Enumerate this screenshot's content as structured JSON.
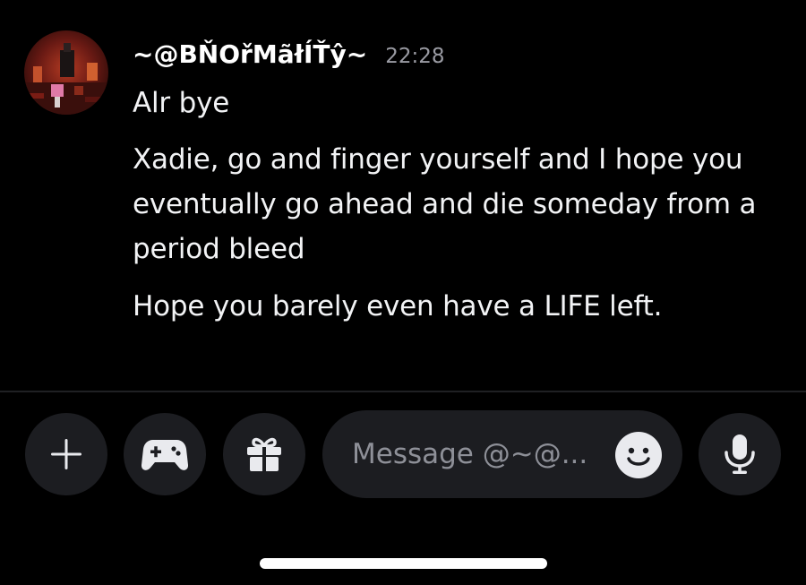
{
  "message": {
    "username": "~@BŇOřMãłÍŤŷ~",
    "timestamp": "22:28",
    "lines": [
      "Alr bye",
      "Xadie, go and finger yourself and I hope you eventually go ahead and die someday from a period bleed",
      "Hope you barely even have a LIFE left."
    ]
  },
  "composer": {
    "placeholder": "Message @~@...",
    "buttons": {
      "plus": "plus-icon",
      "games": "gamepad-icon",
      "gift": "gift-icon",
      "emoji": "smiley-icon",
      "mic": "microphone-icon"
    }
  },
  "colors": {
    "background": "#000000",
    "text": "#f2f3f5",
    "muted": "#9a9ba3",
    "control_bg": "#1c1d21"
  }
}
